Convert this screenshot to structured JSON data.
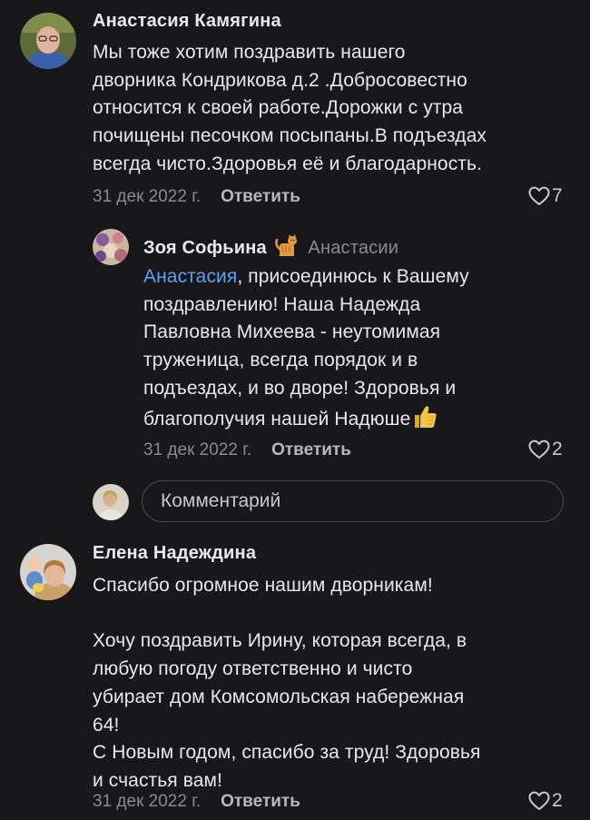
{
  "comments": [
    {
      "author": "Анастасия Камягина",
      "text_lines": [
        "Мы тоже хотим поздравить нашего",
        "дворника Кондрикова д.2 .Добросовестно",
        "относится к своей работе.Дорожки с утра",
        "почищены песочком посыпаны.В подъездах",
        "всегда чисто.Здоровья её и благодарность."
      ],
      "date": "31 дек 2022 г.",
      "reply_label": "Ответить",
      "likes": "7"
    },
    {
      "author": "Зоя Софьина",
      "author_icon": "cat-icon",
      "reply_to": "Анастасии",
      "mention": "Анастасия",
      "text_lines": [
        ", присоединюсь к Вашему",
        "поздравлению! Наша Надежда",
        "Павловна Михеева - неутомимая",
        "труженица, всегда порядок и в",
        "подъездах, и во дворе! Здоровья и",
        "благополучия нашей Надюше"
      ],
      "text_end_icon": "thumbs-up-icon",
      "date": "31 дек 2022 г.",
      "reply_label": "Ответить",
      "likes": "2"
    },
    {
      "author": "Елена Надеждина",
      "paragraph1": "Спасибо огромное нашим дворникам!",
      "paragraph2_lines": [
        "Хочу поздравить Ирину, которая всегда, в",
        "любую погоду ответственно и чисто",
        "убирает дом Комсомольская набережная",
        "64!",
        "С Новым годом, спасибо за труд! Здоровья",
        "и счастья вам!"
      ],
      "date": "31 дек 2022 г.",
      "reply_label": "Ответить",
      "likes": "2"
    }
  ],
  "comment_input": {
    "placeholder": "Комментарий"
  },
  "colors": {
    "background": "#18181a",
    "text": "#e8e8ea",
    "secondary": "#8a8a8f",
    "mention": "#5aa2f0"
  }
}
